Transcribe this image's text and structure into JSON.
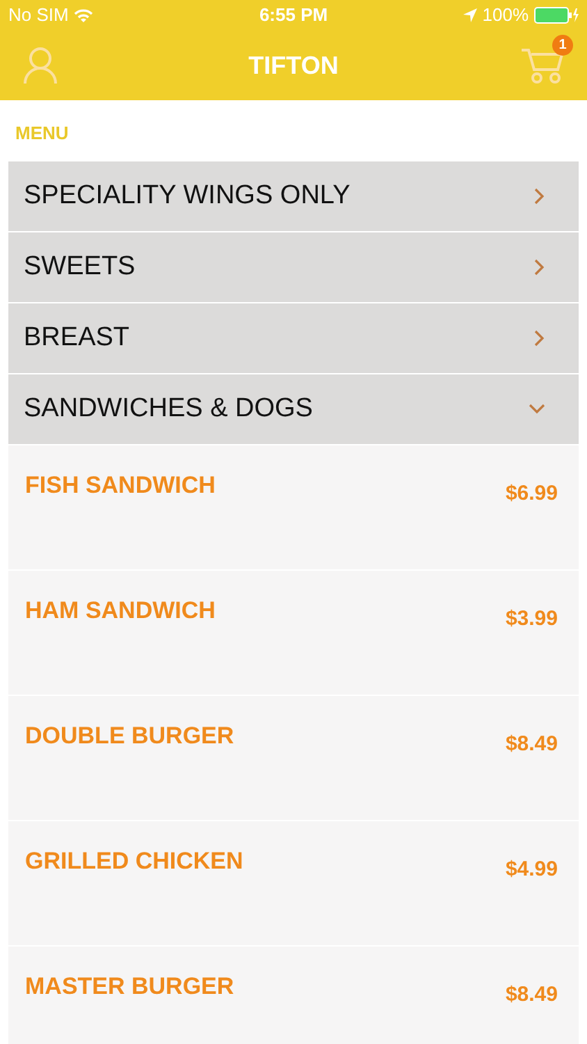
{
  "status_bar": {
    "carrier": "No SIM",
    "time": "6:55 PM",
    "battery": "100%"
  },
  "nav": {
    "title": "TIFTON",
    "cart_count": "1"
  },
  "section_label": "MENU",
  "categories": [
    {
      "name": "SPECIALITY WINGS ONLY",
      "expanded": false
    },
    {
      "name": "SWEETS",
      "expanded": false
    },
    {
      "name": "BREAST",
      "expanded": false
    },
    {
      "name": "SANDWICHES & DOGS",
      "expanded": true,
      "items": [
        {
          "name": "FISH SANDWICH",
          "price": "$6.99"
        },
        {
          "name": "HAM SANDWICH",
          "price": "$3.99"
        },
        {
          "name": "DOUBLE BURGER",
          "price": "$8.49"
        },
        {
          "name": "GRILLED CHICKEN",
          "price": "$4.99"
        },
        {
          "name": "MASTER BURGER",
          "price": "$8.49"
        }
      ]
    }
  ]
}
